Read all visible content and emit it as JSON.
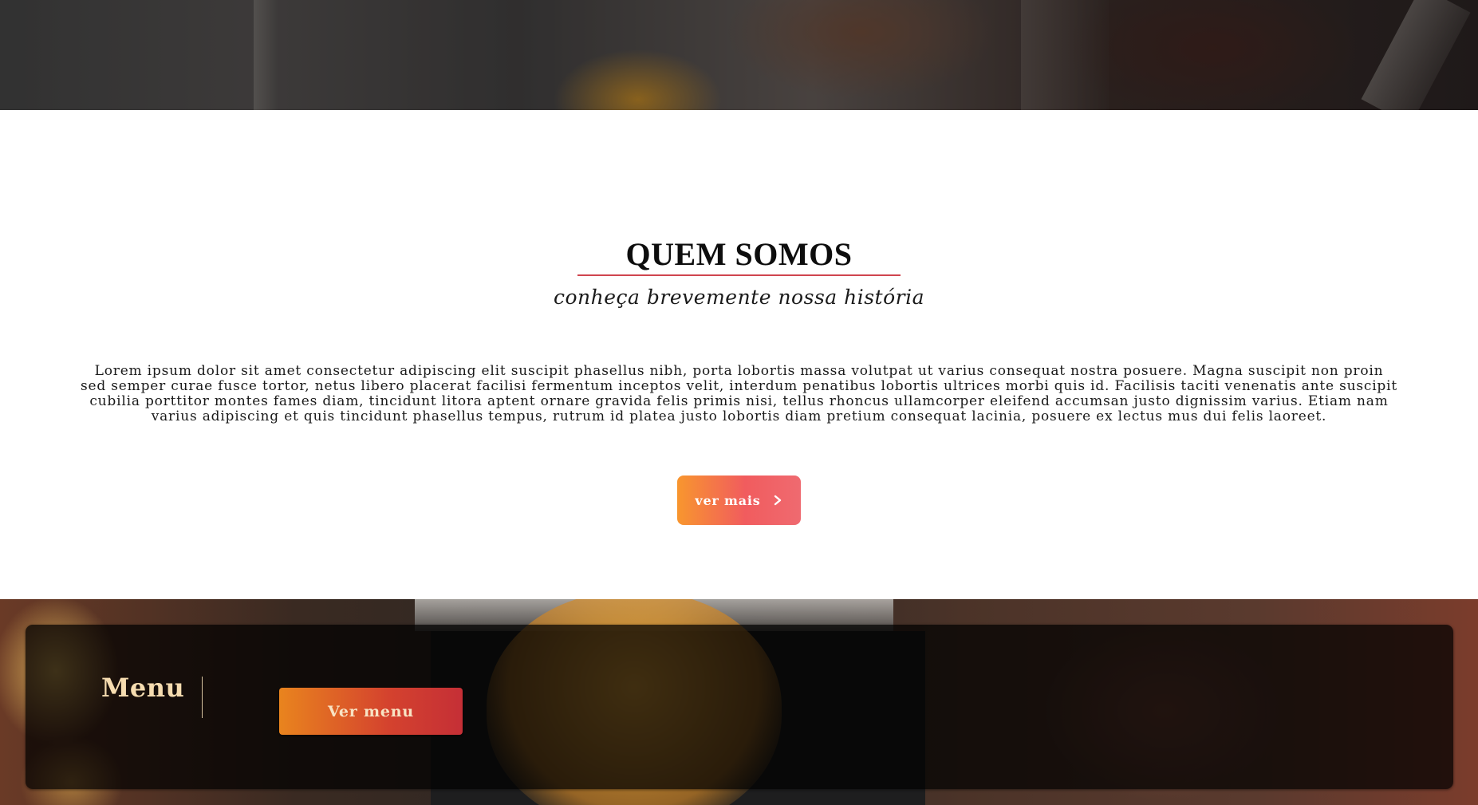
{
  "about": {
    "title": "QUEM SOMOS",
    "subtitle": "conheça brevemente nossa história",
    "body": "Lorem ipsum dolor sit amet consectetur adipiscing elit suscipit phasellus nibh, porta lobortis massa volutpat ut varius consequat nostra posuere. Magna suscipit non proin sed semper curae fusce tortor, netus libero placerat facilisi fermentum inceptos velit, interdum penatibus lobortis ultrices morbi quis id. Facilisis taciti venenatis ante suscipit cubilia porttitor montes fames diam, tincidunt litora aptent ornare gravida felis primis nisi, tellus rhoncus ullamcorper eleifend accumsan justo dignissim varius. Etiam nam varius adipiscing et quis tincidunt phasellus tempus, rutrum id platea justo lobortis diam pretium consequat lacinia, posuere ex lectus mus dui felis laoreet.",
    "more_button_label": "ver mais",
    "more_button_icon": "chevron-right-icon",
    "underline_color": "#d0454e"
  },
  "menu": {
    "title": "Menu",
    "button_label": "Ver menu"
  },
  "colors": {
    "accent_orange": "#f8962e",
    "accent_red": "#f15c5e",
    "menu_title": "#f6dcb0"
  }
}
